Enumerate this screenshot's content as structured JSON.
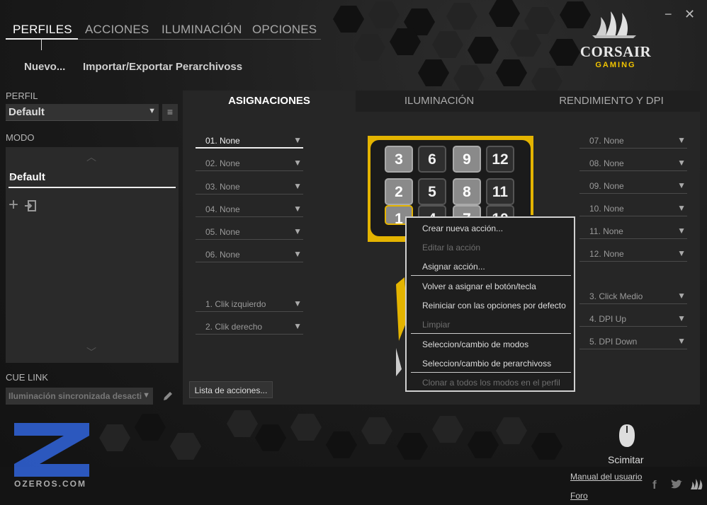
{
  "window": {
    "minimize": "−",
    "close": "✕"
  },
  "nav": {
    "tabs": [
      {
        "label": "PERFILES"
      },
      {
        "label": "ACCIONES"
      },
      {
        "label": "ILUMINACIÓN"
      },
      {
        "label": "OPCIONES"
      }
    ]
  },
  "actions": {
    "new": "Nuevo...",
    "import_export": "Importar/Exportar Perarchivoss"
  },
  "brand": {
    "name": "CORSAIR",
    "sub": "GAMING"
  },
  "profile": {
    "label": "PERFIL",
    "selected": "Default"
  },
  "mode": {
    "label": "MODO",
    "items": [
      {
        "name": "Default"
      }
    ]
  },
  "cue_link": {
    "label": "CUE LINK",
    "selected": "Iluminación sincronizada desacti"
  },
  "main": {
    "tabs": [
      {
        "label": "ASIGNACIONES"
      },
      {
        "label": "ILUMINACIÓN"
      },
      {
        "label": "RENDIMIENTO Y DPI"
      }
    ],
    "left_slots": [
      "01. None",
      "02. None",
      "03. None",
      "04. None",
      "05. None",
      "06. None"
    ],
    "left_buttons": [
      "1. Clik izquierdo",
      "2. Clik derecho"
    ],
    "right_slots": [
      "07. None",
      "08. None",
      "09. None",
      "10. None",
      "11. None",
      "12. None"
    ],
    "right_buttons": [
      "3. Click Medio",
      "4. DPI Up",
      "5. DPI Down"
    ],
    "action_list_button": "Lista de acciones..."
  },
  "keypad": {
    "keys": [
      "3",
      "6",
      "9",
      "12",
      "2",
      "5",
      "8",
      "11",
      "1",
      "4",
      "7",
      "10"
    ]
  },
  "context_menu": {
    "items": [
      {
        "label": "Crear nueva acción...",
        "disabled": false
      },
      {
        "label": "Editar la acción",
        "disabled": true
      },
      {
        "label": "Asignar acción...",
        "disabled": false
      },
      {
        "label": "Volver a asignar el botón/tecla",
        "disabled": false
      },
      {
        "label": "Reiniciar con las opciones por defecto",
        "disabled": false
      },
      {
        "label": "Limpiar",
        "disabled": true
      },
      {
        "label": "Seleccion/cambio de modos",
        "disabled": false
      },
      {
        "label": "Seleccion/cambio de perarchivoss",
        "disabled": false
      },
      {
        "label": "Clonar a todos los modos en el perfil",
        "disabled": true
      }
    ]
  },
  "device": {
    "name": "Scimitar"
  },
  "watermark": {
    "text": "OZEROS.COM"
  },
  "footer": {
    "manual": "Manual del usuario",
    "forum": "Foro"
  },
  "colors": {
    "accent": "#f2c400",
    "background": "#1c1c1c",
    "panel": "#262626"
  }
}
